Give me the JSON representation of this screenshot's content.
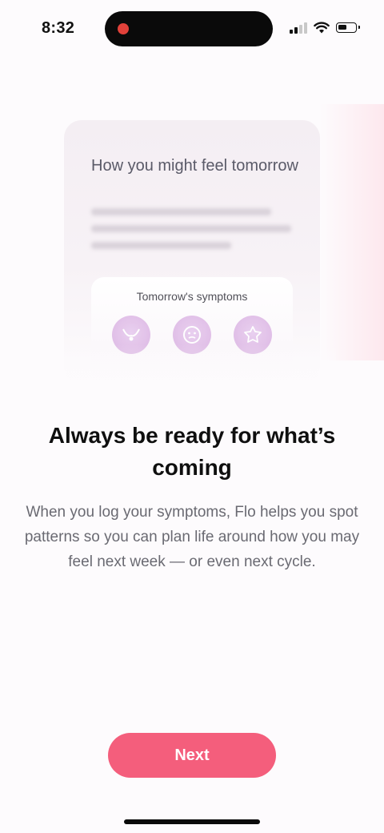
{
  "status_bar": {
    "time": "8:32",
    "recording_dot_color": "#e1413a",
    "signal_icon": "cellular-signal-icon",
    "wifi_icon": "wifi-icon",
    "battery_icon": "battery-icon",
    "battery_level": 0.5
  },
  "illustration": {
    "title": "How you might feel tomorrow",
    "symptoms_title": "Tomorrow's symptoms",
    "symptom_icons": [
      "symptom-bloating-icon",
      "symptom-face-icon",
      "symptom-mood-icon"
    ]
  },
  "onboarding": {
    "headline": "Always be ready for what’s coming",
    "body": "When you log your symptoms, Flo helps you spot patterns so you can plan life around how you may feel next week — or even next cycle."
  },
  "actions": {
    "next_label": "Next",
    "accent_color": "#f45e7c"
  }
}
